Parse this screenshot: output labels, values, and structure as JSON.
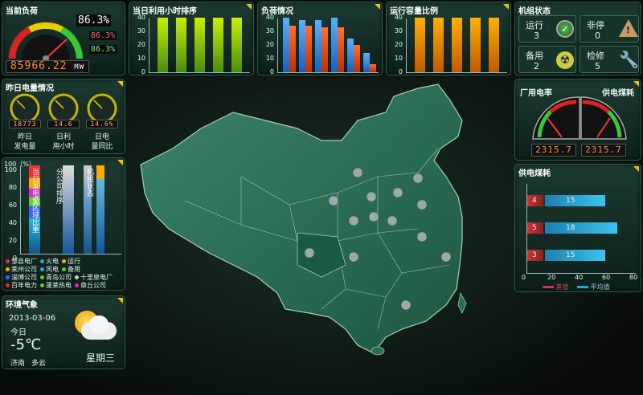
{
  "load_panel": {
    "title": "当前负荷",
    "percent_main": "86.3%",
    "percent_red": "86.3%",
    "percent_green": "86.3%",
    "value": "85966.22",
    "unit": "MW",
    "dial_ticks": [
      "20",
      "40",
      "60",
      "80"
    ]
  },
  "hours_panel": {
    "title": "当日利用小时排序",
    "ticks": [
      "40",
      "30",
      "20",
      "10",
      "0"
    ],
    "values": [
      40,
      40,
      40,
      40,
      40
    ]
  },
  "loadstatus_panel": {
    "title": "负荷情况",
    "ticks": [
      "40",
      "30",
      "20",
      "10",
      "0"
    ],
    "blue": [
      40,
      38,
      38,
      40,
      25,
      14
    ],
    "orange": [
      34,
      34,
      33,
      33,
      20,
      6
    ]
  },
  "capacity_panel": {
    "title": "运行容量比例",
    "ticks": [
      "40",
      "30",
      "20",
      "10",
      "0"
    ],
    "values": [
      40,
      40,
      40,
      40,
      40
    ]
  },
  "unit_panel": {
    "title": "机组状态",
    "items": [
      {
        "label": "运行",
        "value": "3"
      },
      {
        "label": "非停",
        "value": "0"
      },
      {
        "label": "备用",
        "value": "2"
      },
      {
        "label": "检修",
        "value": "5"
      }
    ]
  },
  "yesterday_panel": {
    "title": "昨日电量情况",
    "gauges": [
      {
        "value": "18773",
        "label1": "昨日",
        "label2": "发电量"
      },
      {
        "value": "14.6",
        "label1": "日利",
        "label2": "用小时"
      },
      {
        "value": "14.6%",
        "label1": "日电",
        "label2": "量同比"
      }
    ]
  },
  "plant_panel": {
    "title1": "厂用电率",
    "title2": "供电煤耗",
    "value1": "2315.7",
    "value2": "2315.7"
  },
  "vbar_panel": {
    "axis_title": "100（%）",
    "ticks": [
      "100",
      "80",
      "60",
      "40",
      "20",
      "0"
    ],
    "label_left": "当日发电量区域比重",
    "label_mid": "分公司排序",
    "label_right": "机组状态",
    "legend": [
      [
        {
          "c": "#d33",
          "t": "邹县电厂"
        },
        {
          "c": "#3ac",
          "t": "火电"
        },
        {
          "c": "#fa0",
          "t": "运行"
        }
      ],
      [
        {
          "c": "#fa0",
          "t": "莱州公司"
        },
        {
          "c": "#3ac",
          "t": "风电"
        },
        {
          "c": "#6c3",
          "t": "备用"
        }
      ],
      [
        {
          "c": "#36f",
          "t": "淄博公司"
        },
        {
          "c": "#6c3",
          "t": "青岛公司"
        },
        {
          "c": "#ccc",
          "t": "十里泉电厂"
        }
      ],
      [
        {
          "c": "#e23",
          "t": "百年电力"
        },
        {
          "c": "#6c3",
          "t": "蓬莱热电"
        },
        {
          "c": "#c3c",
          "t": "章丘公司"
        }
      ]
    ]
  },
  "coal_panel": {
    "title": "供电煤耗",
    "bars": [
      {
        "diff": "4",
        "avg": "15"
      },
      {
        "diff": "5",
        "avg": "18"
      },
      {
        "diff": "3",
        "avg": "15"
      }
    ],
    "axis": [
      "0",
      "20",
      "40",
      "60",
      "80"
    ],
    "legend_diff": "差值",
    "legend_avg": "平均值"
  },
  "weather_panel": {
    "title": "环境气象",
    "date": "2013-03-06",
    "today": "今日",
    "temp": "-5℃",
    "city": "济南",
    "condition": "多云",
    "weekday": "星期三"
  }
}
